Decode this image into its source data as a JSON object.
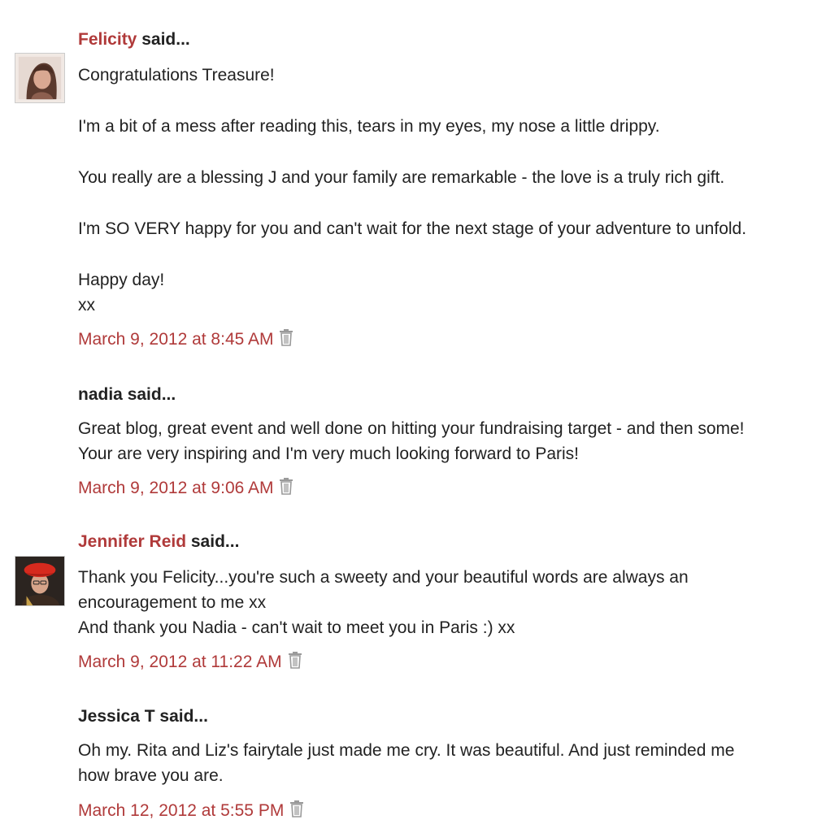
{
  "said_suffix": " said...",
  "comments": [
    {
      "author": "Felicity",
      "author_linked": true,
      "has_avatar": true,
      "avatar_icon": "avatar-photo-woman",
      "paragraphs": [
        [
          "Congratulations Treasure!"
        ],
        [
          "I'm a bit of a mess after reading this, tears in my eyes, my nose a little drippy."
        ],
        [
          "You really are a blessing J and your family are remarkable - the love is a truly rich gift."
        ],
        [
          "I'm SO VERY happy for you and can't wait for the next stage of your adventure to unfold."
        ],
        [
          "Happy day!",
          "xx"
        ]
      ],
      "timestamp": "March 9, 2012 at 8:45 AM",
      "delete_icon": "trash-icon"
    },
    {
      "author": "nadia",
      "author_linked": false,
      "has_avatar": false,
      "paragraphs": [
        [
          "Great blog, great event and well done on hitting your fundraising target - and then some!",
          "Your are very inspiring and I'm very much looking forward to Paris!"
        ]
      ],
      "timestamp": "March 9, 2012 at 9:06 AM",
      "delete_icon": "trash-icon"
    },
    {
      "author": "Jennifer Reid",
      "author_linked": true,
      "has_avatar": true,
      "avatar_icon": "avatar-photo-red-beret",
      "paragraphs": [
        [
          "Thank you Felicity...you're such a sweety and your beautiful words are always an",
          "encouragement to me xx",
          "And thank you Nadia - can't wait to meet you in Paris :) xx"
        ]
      ],
      "timestamp": "March 9, 2012 at 11:22 AM",
      "delete_icon": "trash-icon"
    },
    {
      "author": "Jessica T",
      "author_linked": false,
      "has_avatar": false,
      "paragraphs": [
        [
          "Oh my. Rita and Liz's fairytale just made me cry. It was beautiful. And just reminded me",
          "how brave you are."
        ]
      ],
      "timestamp": "March 12, 2012 at 5:55 PM",
      "delete_icon": "trash-icon"
    }
  ],
  "colors": {
    "link": "#b03a3a",
    "text": "#222222",
    "icon": "#9a9a9a"
  }
}
